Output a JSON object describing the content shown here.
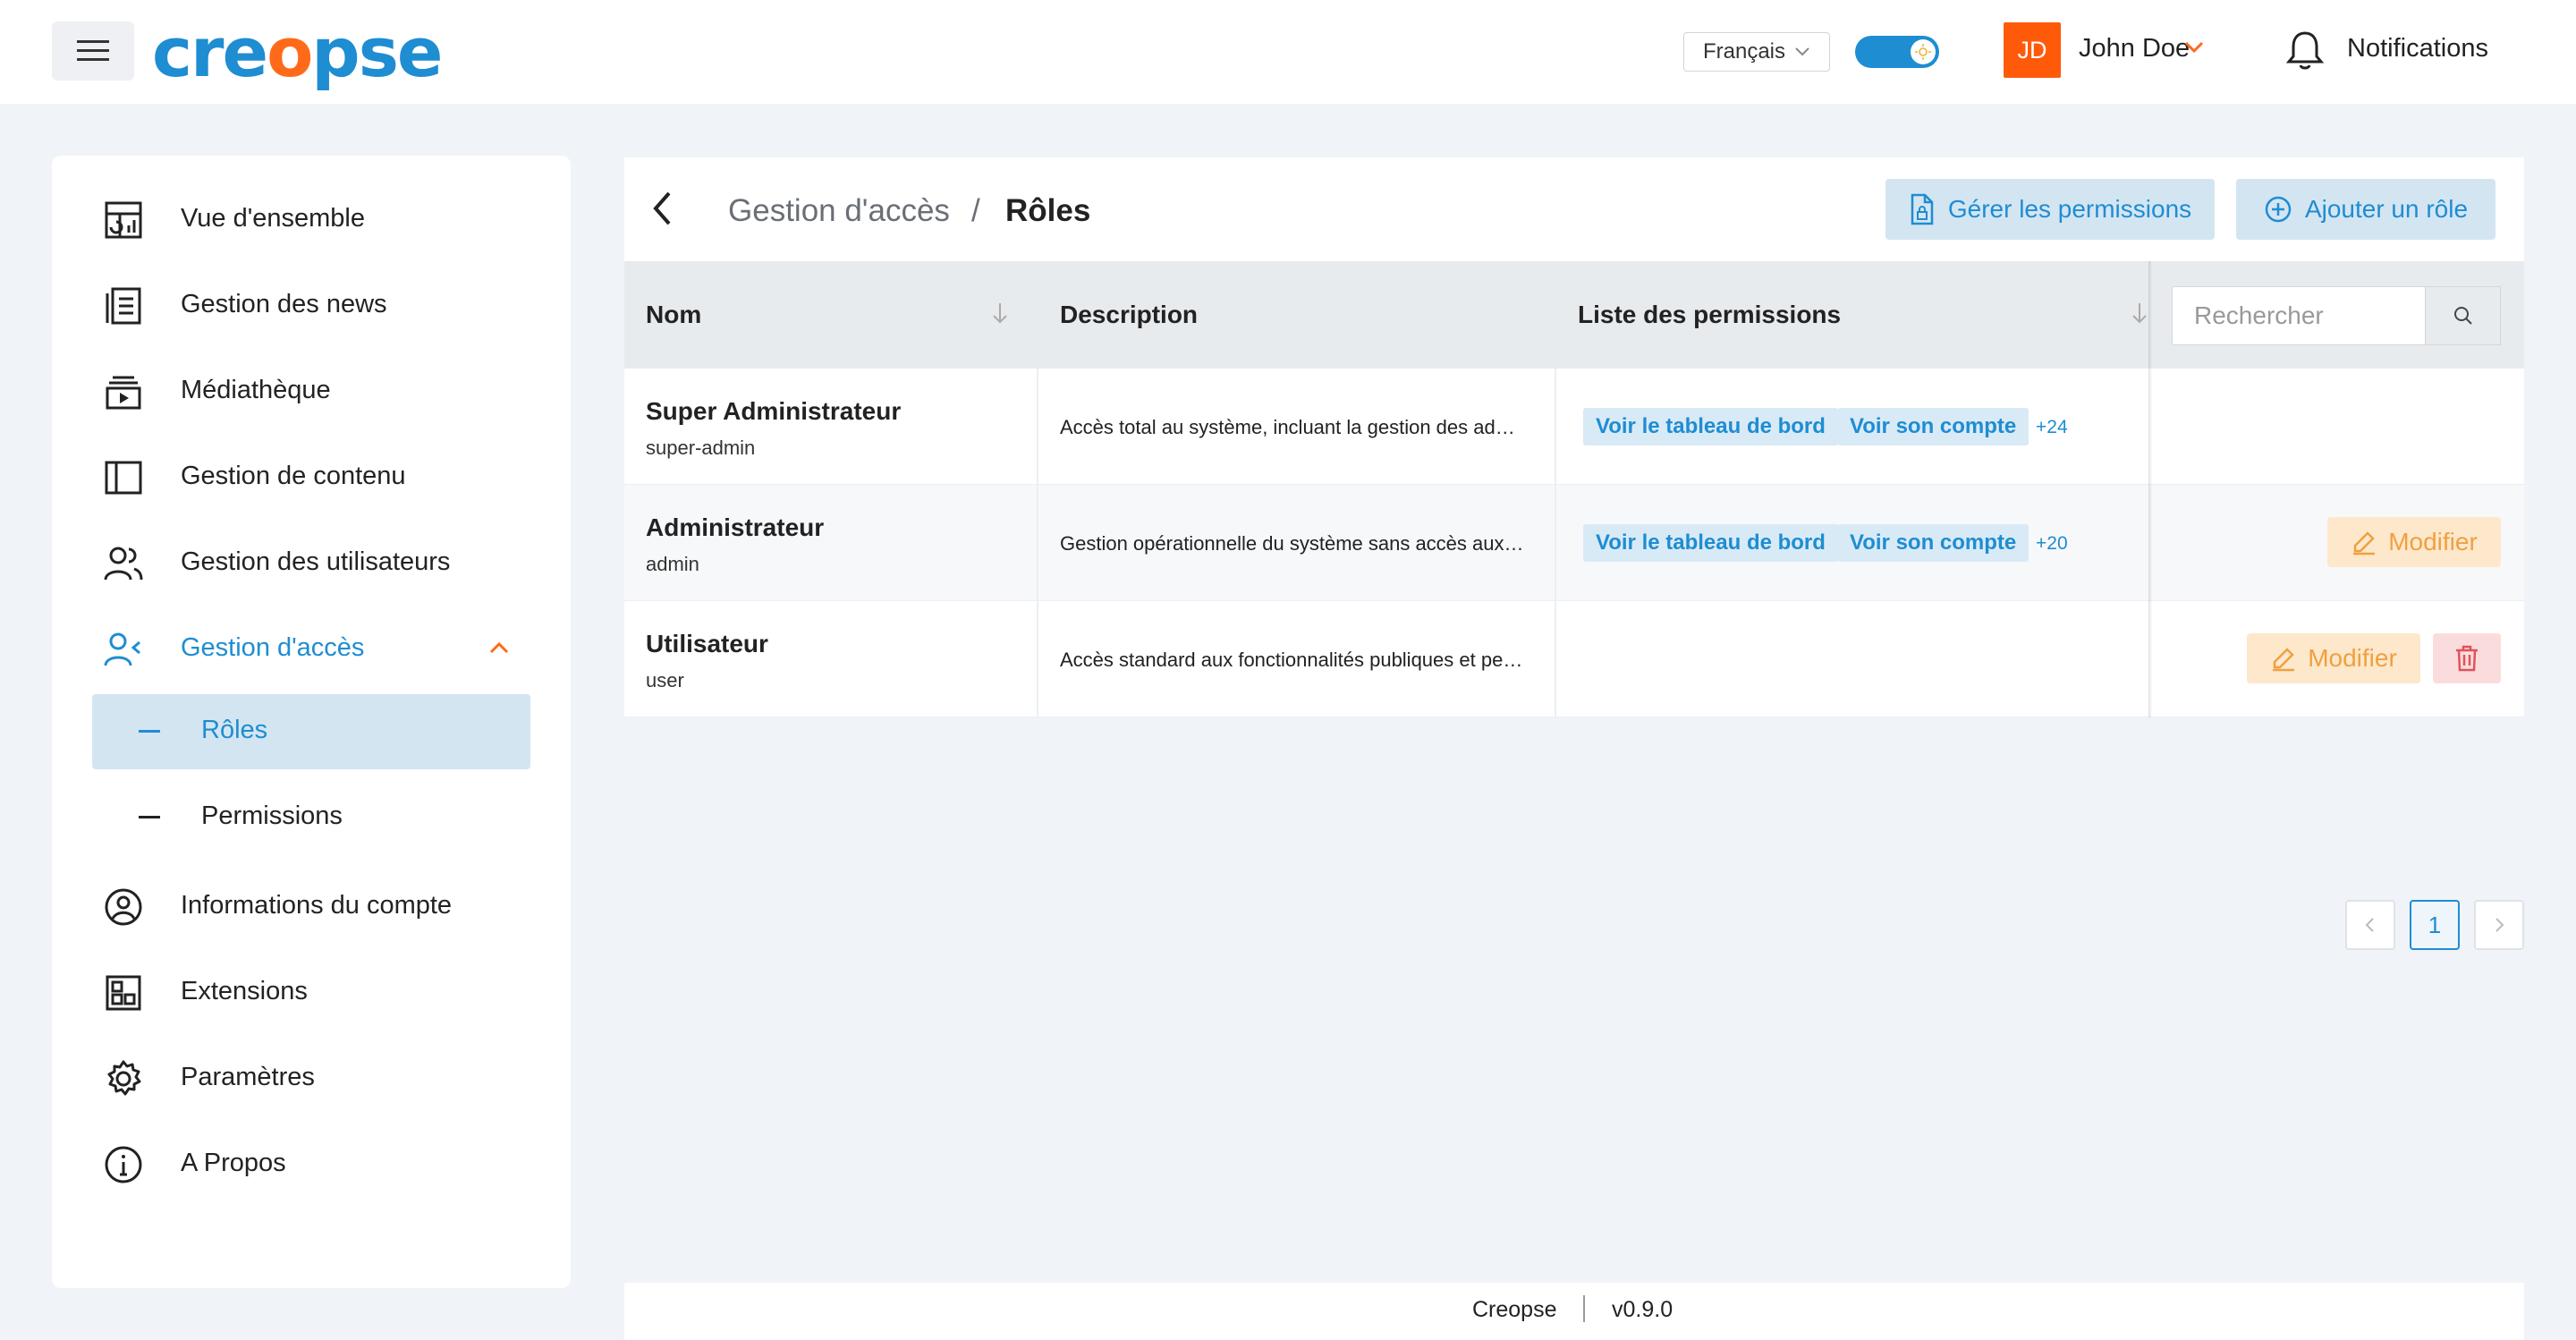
{
  "header": {
    "logo_left": "cre",
    "logo_dot": "o",
    "logo_right": "pse",
    "language": "Français",
    "avatar_initials": "JD",
    "user_name": "John Doe",
    "notifications_label": "Notifications"
  },
  "sidebar": {
    "items": [
      {
        "label": "Vue d'ensemble",
        "icon": "dashboard-icon"
      },
      {
        "label": "Gestion des news",
        "icon": "news-icon"
      },
      {
        "label": "Médiathèque",
        "icon": "media-icon"
      },
      {
        "label": "Gestion de contenu",
        "icon": "content-icon"
      },
      {
        "label": "Gestion des utilisateurs",
        "icon": "users-icon"
      },
      {
        "label": "Gestion d'accès",
        "icon": "access-icon"
      },
      {
        "label": "Informations du compte",
        "icon": "account-icon"
      },
      {
        "label": "Extensions",
        "icon": "extensions-icon"
      },
      {
        "label": "Paramètres",
        "icon": "settings-icon"
      },
      {
        "label": "A Propos",
        "icon": "info-icon"
      }
    ],
    "sub_items": [
      {
        "label": "Rôles"
      },
      {
        "label": "Permissions"
      }
    ]
  },
  "breadcrumb": {
    "parent": "Gestion d'accès",
    "separator": "/",
    "current": "Rôles"
  },
  "actions": {
    "manage_permissions": "Gérer les permissions",
    "add_role": "Ajouter un rôle"
  },
  "table": {
    "columns": [
      "Nom",
      "Description",
      "Liste des permissions"
    ],
    "search_placeholder": "Rechercher",
    "rows": [
      {
        "name": "Super Administrateur",
        "slug": "super-admin",
        "description": "Accès total au système, incluant la gestion des administrateurs et de la configuration",
        "permissions": [
          "Voir le tableau de bord",
          "Voir son compte"
        ],
        "more": "+24"
      },
      {
        "name": "Administrateur",
        "slug": "admin",
        "description": "Gestion opérationnelle du système sans accès aux paramètres critiques",
        "permissions": [
          "Voir le tableau de bord",
          "Voir son compte"
        ],
        "more": "+20",
        "edit_label": "Modifier"
      },
      {
        "name": "Utilisateur",
        "slug": "user",
        "description": "Accès standard aux fonctionnalités publiques et personnelles",
        "permissions": [],
        "edit_label": "Modifier"
      }
    ]
  },
  "pagination": {
    "current_page": "1"
  },
  "footer": {
    "app_name": "Creopse",
    "version": "v0.9.0"
  },
  "colors": {
    "accent": "#1e8dd2",
    "brand_orange": "#ff5a0a",
    "edit": "#f0a040",
    "delete": "#e0525a"
  }
}
